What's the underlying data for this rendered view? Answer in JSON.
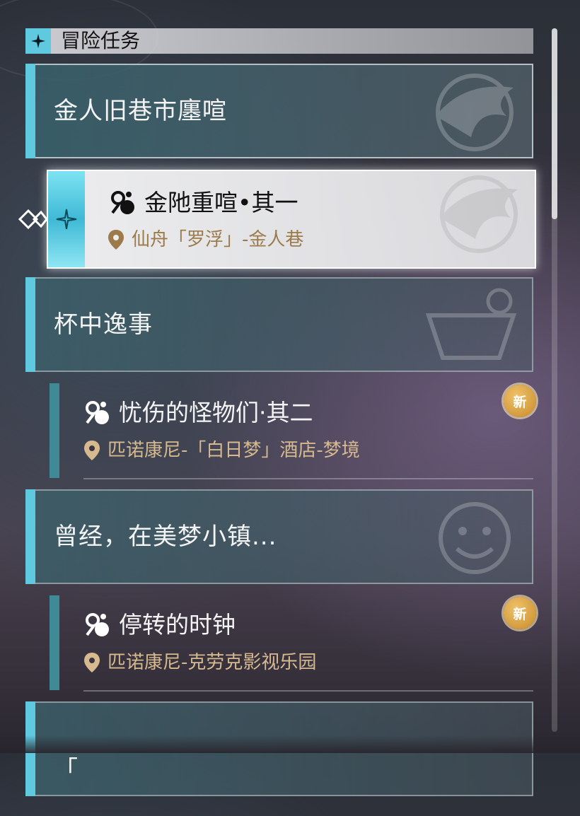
{
  "header": {
    "title": "冒险任务"
  },
  "categories": [
    {
      "title": "金人旧巷市廛喧"
    },
    {
      "title": "杯中逸事"
    },
    {
      "title": "曾经，在美梦小镇..."
    },
    {
      "title": "「",
      "partial": true
    }
  ],
  "selected_quest": {
    "title": "金阤重喧•其一",
    "location": "仙舟「罗浮」-金人巷"
  },
  "quests": [
    {
      "title": "忧伤的怪物们·其二",
      "location": "匹诺康尼-「白日梦」酒店-梦境",
      "badge": "新"
    },
    {
      "title": "停转的时钟",
      "location": "匹诺康尼-克劳克影视乐园",
      "badge": "新"
    }
  ],
  "colors": {
    "accent_cyan": "#5fc9e0",
    "location_gold": "#d6b98e",
    "badge_gold": "#e0a445"
  }
}
